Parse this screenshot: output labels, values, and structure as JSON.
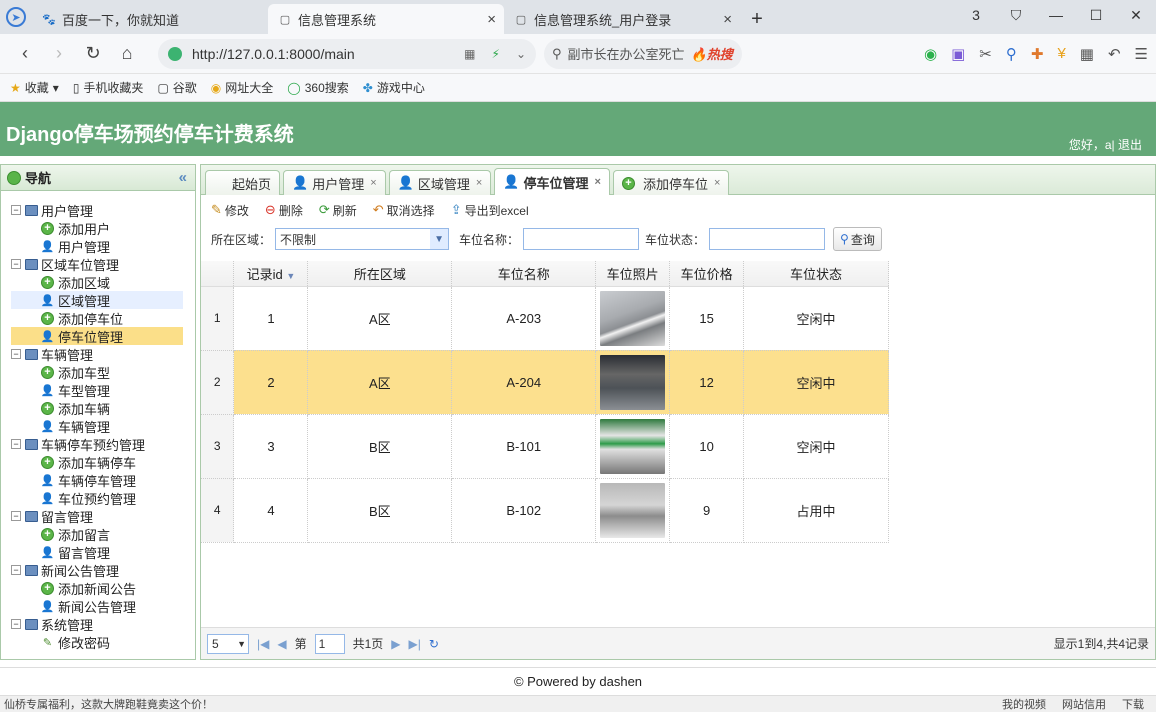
{
  "browser": {
    "tabs": [
      {
        "label": "百度一下，你就知道",
        "icon": "paw-icon"
      },
      {
        "label": "信息管理系统",
        "icon": "page-icon"
      },
      {
        "label": "信息管理系统_用户登录",
        "icon": "page-icon"
      }
    ],
    "close_glyph": "×",
    "new_tab_glyph": "+",
    "tab_count": "3",
    "url": "http://127.0.0.1:8000/main",
    "search_text": "副市长在办公室死亡",
    "search_hot": "🔥热搜",
    "bookmarks": [
      "收藏",
      "手机收藏夹",
      "谷歌",
      "网址大全",
      "360搜索",
      "游戏中心"
    ]
  },
  "app": {
    "title": "Django停车场预约停车计费系统",
    "greeting": "您好，a| 退出",
    "footer": "© Powered by dashen"
  },
  "sidebar": {
    "title": "导航",
    "groups": [
      {
        "label": "用户管理",
        "items": [
          "添加用户",
          "用户管理"
        ]
      },
      {
        "label": "区域车位管理",
        "items": [
          "添加区域",
          "区域管理",
          "添加停车位",
          "停车位管理"
        ]
      },
      {
        "label": "车辆管理",
        "items": [
          "添加车型",
          "车型管理",
          "添加车辆",
          "车辆管理"
        ]
      },
      {
        "label": "车辆停车预约管理",
        "items": [
          "添加车辆停车",
          "车辆停车管理",
          "车位预约管理"
        ]
      },
      {
        "label": "留言管理",
        "items": [
          "添加留言",
          "留言管理"
        ]
      },
      {
        "label": "新闻公告管理",
        "items": [
          "添加新闻公告",
          "新闻公告管理"
        ]
      },
      {
        "label": "系统管理",
        "items": [
          "修改密码"
        ]
      }
    ]
  },
  "tabs": [
    "起始页",
    "用户管理",
    "区域管理",
    "停车位管理",
    "添加停车位"
  ],
  "toolbar": {
    "edit": "修改",
    "delete": "删除",
    "refresh": "刷新",
    "cancel_select": "取消选择",
    "export": "导出到excel"
  },
  "filter": {
    "area_label": "所在区域：",
    "area_value": "不限制",
    "name_label": "车位名称：",
    "status_label": "车位状态：",
    "query": "查询"
  },
  "grid": {
    "columns": [
      "记录id",
      "所在区域",
      "车位名称",
      "车位照片",
      "车位价格",
      "车位状态"
    ],
    "rows": [
      {
        "rn": "1",
        "id": "1",
        "area": "A区",
        "name": "A-203",
        "price": "15",
        "status": "空闲中"
      },
      {
        "rn": "2",
        "id": "2",
        "area": "A区",
        "name": "A-204",
        "price": "12",
        "status": "空闲中"
      },
      {
        "rn": "3",
        "id": "3",
        "area": "B区",
        "name": "B-101",
        "price": "10",
        "status": "空闲中"
      },
      {
        "rn": "4",
        "id": "4",
        "area": "B区",
        "name": "B-102",
        "price": "9",
        "status": "占用中"
      }
    ]
  },
  "pager": {
    "page_size": "5",
    "page_prefix": "第",
    "page": "1",
    "page_total": "共1页",
    "info": "显示1到4,共4记录"
  },
  "statusbar": {
    "left": "仙桥专属福利，这款大牌跑鞋竟卖这个价！",
    "items": [
      "我的视频",
      "网站信用",
      "下载"
    ]
  },
  "colors": {
    "header": "#64a878",
    "selected_row": "#fce08e",
    "border": "#aac9a9"
  }
}
